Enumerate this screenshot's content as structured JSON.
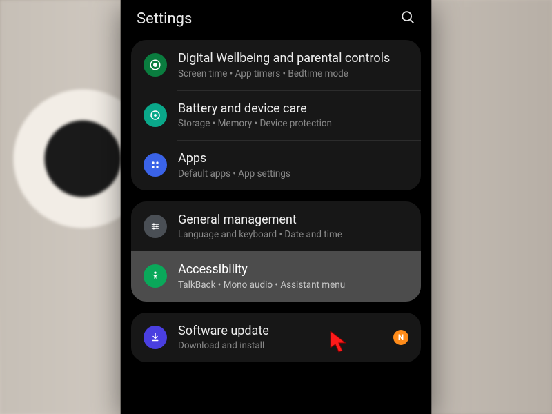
{
  "header": {
    "title": "Settings"
  },
  "groups": [
    {
      "items": [
        {
          "id": "wellbeing",
          "title": "Digital Wellbeing and parental controls",
          "sub": "Screen time  •  App timers  •  Bedtime mode",
          "iconColor": "#0a7d3f",
          "highlight": false,
          "badge": null
        },
        {
          "id": "battery",
          "title": "Battery and device care",
          "sub": "Storage  •  Memory  •  Device protection",
          "iconColor": "#0aa88a",
          "highlight": false,
          "badge": null
        },
        {
          "id": "apps",
          "title": "Apps",
          "sub": "Default apps  •  App settings",
          "iconColor": "#3a63e8",
          "highlight": false,
          "badge": null
        }
      ]
    },
    {
      "items": [
        {
          "id": "general",
          "title": "General management",
          "sub": "Language and keyboard  •  Date and time",
          "iconColor": "#4a4f55",
          "highlight": false,
          "badge": null
        },
        {
          "id": "accessibility",
          "title": "Accessibility",
          "sub": "TalkBack  •  Mono audio  •  Assistant menu",
          "iconColor": "#0aa85a",
          "highlight": true,
          "badge": null
        }
      ]
    },
    {
      "items": [
        {
          "id": "software",
          "title": "Software update",
          "sub": "Download and install",
          "iconColor": "#4a3fe0",
          "highlight": false,
          "badge": "N"
        }
      ]
    }
  ],
  "icons": {
    "wellbeing": "target-icon",
    "battery": "gauge-icon",
    "apps": "grid-icon",
    "general": "sliders-icon",
    "accessibility": "person-icon",
    "software": "download-icon"
  }
}
